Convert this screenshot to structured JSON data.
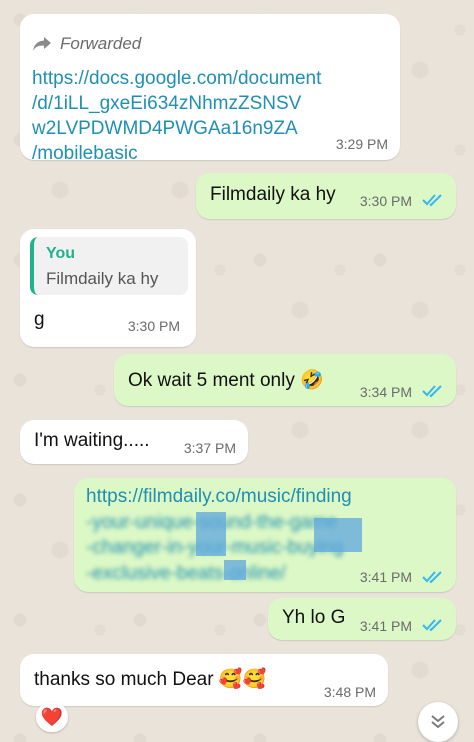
{
  "colors": {
    "incoming_bubble": "#ffffff",
    "outgoing_bubble": "#dcf8c6",
    "link": "#1f8fb3",
    "read_ticks": "#34b7f1",
    "quote_accent": "#20b38b"
  },
  "messages": {
    "m1": {
      "forwarded_label": "Forwarded",
      "link_lines": [
        "https://docs.google.com/document",
        "/d/1iLL_gxeEi634zNhmzZSNSV",
        "w2LVPDWMD4PWGAa16n9ZA",
        "/mobilebasic"
      ],
      "time": "3:29 PM"
    },
    "m2": {
      "text": "Filmdaily ka hy",
      "time": "3:30 PM",
      "status_icon": "double-check-read-icon"
    },
    "m3": {
      "quote_author": "You",
      "quote_text": "Filmdaily ka hy",
      "text": "g",
      "time": "3:30 PM"
    },
    "m4": {
      "text": "Ok wait 5 ment only 🤣",
      "time": "3:34 PM",
      "status_icon": "double-check-read-icon"
    },
    "m5": {
      "text": "I'm waiting.....",
      "time": "3:37 PM"
    },
    "m6": {
      "link_lines": [
        "https://filmdaily.co/music/finding",
        "-your-unique-sound-the-game",
        "-changer-in-your-music-buying",
        "-exclusive-beats-online/"
      ],
      "time": "3:41 PM",
      "status_icon": "double-check-read-icon"
    },
    "m7": {
      "text": "Yh lo G",
      "time": "3:41 PM",
      "status_icon": "double-check-read-icon"
    },
    "m8": {
      "text": "thanks so much Dear 🥰🥰",
      "time": "3:48 PM",
      "reaction": "❤️"
    }
  },
  "scroll_button_icon": "double-chevron-down-icon"
}
